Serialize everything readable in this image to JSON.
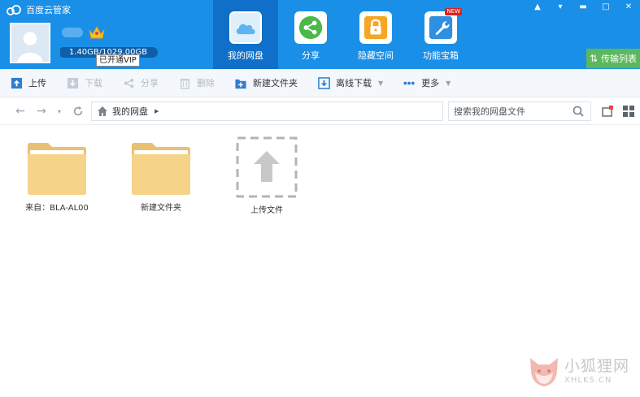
{
  "app": {
    "title": "百度云管家"
  },
  "window_controls": {
    "minimize": "▬",
    "close": "✕",
    "maximize": "□",
    "menu": "▾",
    "skin": "▲"
  },
  "user": {
    "quota_text": "1.40GB/1029.00GB",
    "quota_used_fraction": 0.0014,
    "vip_tooltip": "已开通VIP"
  },
  "nav": {
    "items": [
      {
        "label": "我的网盘",
        "icon": "cloud-icon",
        "active": true
      },
      {
        "label": "分享",
        "icon": "share-icon",
        "active": false
      },
      {
        "label": "隐藏空间",
        "icon": "lock-icon",
        "active": false
      },
      {
        "label": "功能宝箱",
        "icon": "wrench-icon",
        "active": false,
        "badge": "NEW"
      }
    ],
    "transfer_list": "传输列表"
  },
  "toolbar": {
    "upload": "上传",
    "download": "下载",
    "share": "分享",
    "delete": "删除",
    "new_folder": "新建文件夹",
    "offline_download": "离线下载",
    "more": "更多"
  },
  "address": {
    "path": "我的网盘",
    "search_placeholder": "搜索我的网盘文件"
  },
  "files": [
    {
      "name": "来自：BLA-AL00",
      "type": "folder"
    },
    {
      "name": "新建文件夹",
      "type": "folder"
    },
    {
      "name": "上传文件",
      "type": "upload"
    }
  ],
  "watermark": {
    "cn": "小狐狸网",
    "en": "XHLKS.CN"
  },
  "colors": {
    "header_blue": "#1a8fe8",
    "nav_active": "#0f6fc9",
    "transfer_green": "#5cb85c",
    "folder_yellow": "#f5d48a"
  }
}
